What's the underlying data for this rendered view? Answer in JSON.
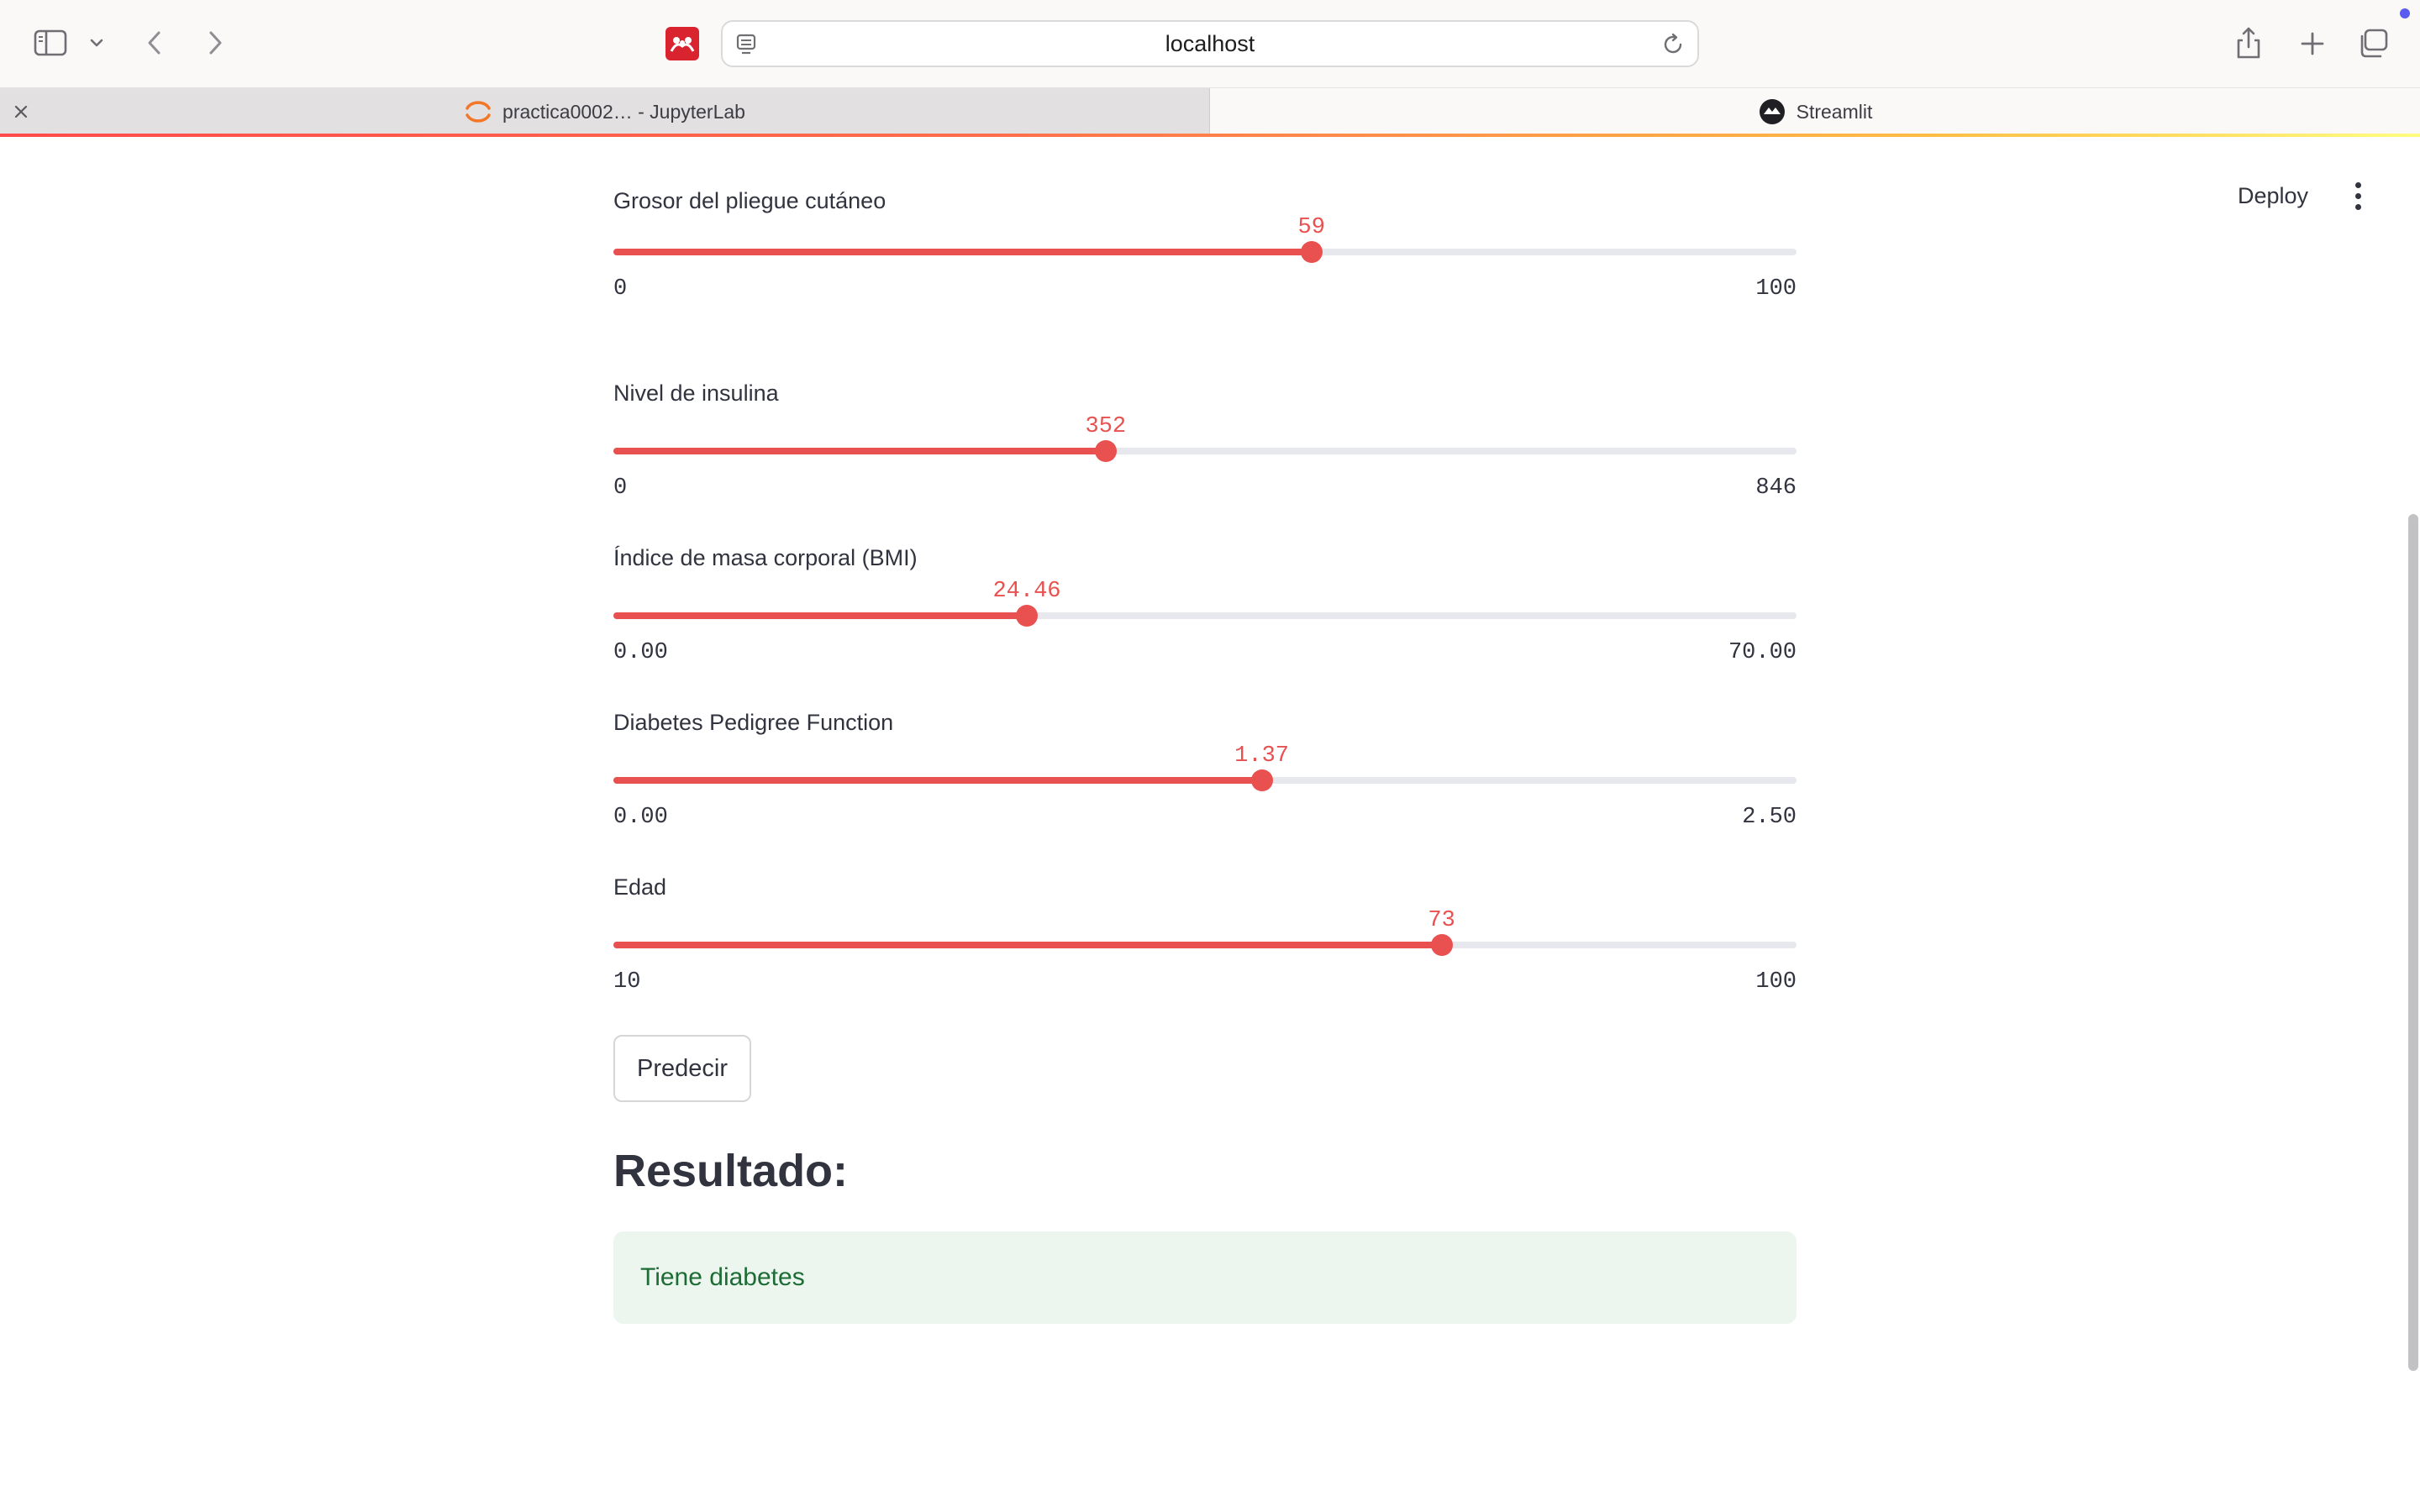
{
  "browser": {
    "url": "localhost",
    "tabs": [
      {
        "label": "practica0002… - JupyterLab",
        "active": false
      },
      {
        "label": "Streamlit",
        "active": true
      }
    ],
    "icons": [
      "sidebar-icon",
      "chevron-down-icon",
      "back-arrow-icon",
      "forward-arrow-icon",
      "mendeley-icon",
      "site-settings-icon",
      "reload-icon",
      "share-icon",
      "plus-icon",
      "tab-overview-icon",
      "close-icon"
    ]
  },
  "header": {
    "deploy_label": "Deploy",
    "menu_icon": "kebab-menu-icon"
  },
  "sliders": [
    {
      "label": "Grosor del pliegue cutáneo",
      "value": 59,
      "value_text": "59",
      "min": 0,
      "max": 100,
      "min_text": "0",
      "max_text": "100"
    },
    {
      "label": "Nivel de insulina",
      "value": 352,
      "value_text": "352",
      "min": 0,
      "max": 846,
      "min_text": "0",
      "max_text": "846"
    },
    {
      "label": "Índice de masa corporal (BMI)",
      "value": 24.46,
      "value_text": "24.46",
      "min": 0,
      "max": 70,
      "min_text": "0.00",
      "max_text": "70.00"
    },
    {
      "label": "Diabetes Pedigree Function",
      "value": 1.37,
      "value_text": "1.37",
      "min": 0,
      "max": 2.5,
      "min_text": "0.00",
      "max_text": "2.50"
    },
    {
      "label": "Edad",
      "value": 73,
      "value_text": "73",
      "min": 10,
      "max": 100,
      "min_text": "10",
      "max_text": "100"
    }
  ],
  "predict_label": "Predecir",
  "result": {
    "heading": "Resultado:",
    "message": "Tiene diabetes"
  },
  "colors": {
    "accent": "#e8514f",
    "success_bg": "#ecf6ee",
    "success_text": "#1d6b35"
  }
}
